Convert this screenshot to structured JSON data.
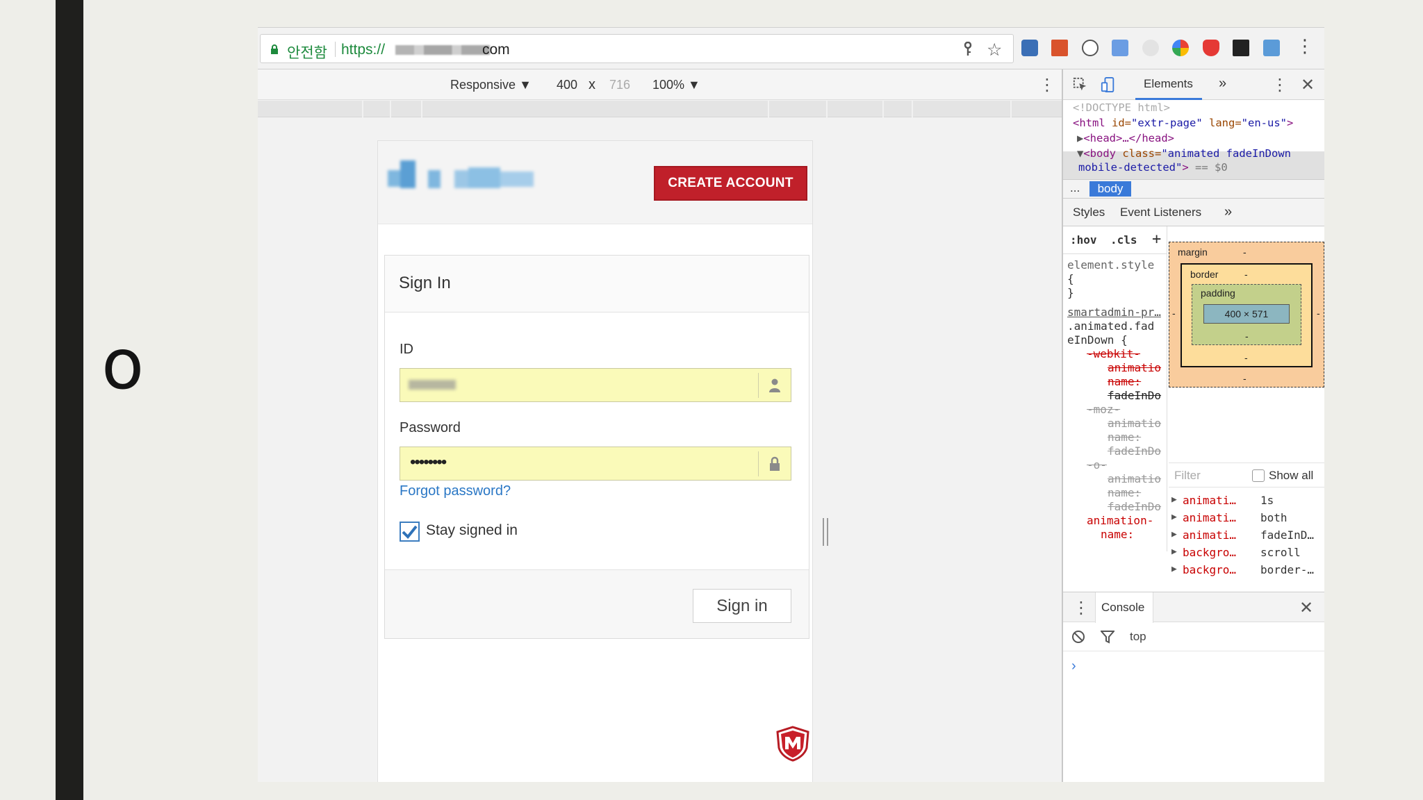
{
  "slide": {
    "bullet": "o"
  },
  "browser": {
    "address_bar": {
      "secure_label": "안전함",
      "url_scheme": "https://",
      "url_tld": "com"
    },
    "icons": {
      "lock": "lock-icon",
      "key": "key-icon",
      "star": "star-icon",
      "menu": "kebab-menu-icon"
    }
  },
  "device_toolbar": {
    "mode": "Responsive",
    "width": "400",
    "times": "x",
    "height": "716",
    "zoom": "100%"
  },
  "page": {
    "create_account_label": "CREATE ACCOUNT",
    "sign_in_title": "Sign In",
    "id_label": "ID",
    "password_label": "Password",
    "password_value": "••••••••",
    "forgot_label": "Forgot password?",
    "stay_signed_in_label": "Stay signed in",
    "stay_signed_in_checked": true,
    "sign_in_button_label": "Sign in",
    "colors": {
      "brand_red": "#c0202a",
      "autofill_yellow": "#fafab9",
      "link_blue": "#2a77c5"
    }
  },
  "devtools": {
    "tabs": {
      "elements": "Elements",
      "more": "»"
    },
    "dom": {
      "doctype": "<!DOCTYPE html>",
      "html_open": "<html",
      "html_id_attr": " id=",
      "html_id_val": "\"extr-page\"",
      "html_lang_attr": " lang=",
      "html_lang_val": "\"en-us\"",
      "html_close": ">",
      "head": "<head>…</head>",
      "body_open": "<body",
      "body_class_attr": " class=",
      "body_class_val": "\"animated fadeInDown",
      "body_class_val2": "mobile-detected\"",
      "body_close": ">",
      "body_eq": " == $0"
    },
    "breadcrumb": {
      "ellipsis": "...",
      "body": "body"
    },
    "styles_tabs": {
      "styles": "Styles",
      "event_listeners": "Event Listeners",
      "more": "»"
    },
    "styles": {
      "hov": ":hov",
      "cls": ".cls",
      "plus": "+",
      "element_style": "element.style",
      "brace_open": "{",
      "brace_close": "}",
      "source_link": "smartadmin-pr…",
      "selector1": ".animated.fad",
      "selector2": "eInDown {",
      "webkit_prefix": "-webkit-",
      "webkit_prop1": "animatio",
      "webkit_prop2": "name:",
      "webkit_val": "fadeInDo",
      "moz_prefix": "-moz-",
      "moz_prop1": "animatio",
      "moz_prop2": "name:",
      "moz_val": "fadeInDo",
      "o_prefix": "-o-",
      "o_prop1": "animatio",
      "o_prop2": "name:",
      "o_val": "fadeInDo",
      "anim_prop1": "animation-",
      "anim_prop2": "name:"
    },
    "box_model": {
      "margin": "margin",
      "border": "border",
      "padding": "padding",
      "dash": "-",
      "content": "400 × 571"
    },
    "computed": {
      "filter_placeholder": "Filter",
      "show_all": "Show all",
      "rows": [
        {
          "prop": "animati…",
          "value": "1s"
        },
        {
          "prop": "animati…",
          "value": "both"
        },
        {
          "prop": "animati…",
          "value": "fadeInD…"
        },
        {
          "prop": "backgro…",
          "value": "scroll"
        },
        {
          "prop": "backgro…",
          "value": "border-…"
        }
      ]
    },
    "console": {
      "tab": "Console",
      "context": "top",
      "prompt": "›"
    }
  }
}
